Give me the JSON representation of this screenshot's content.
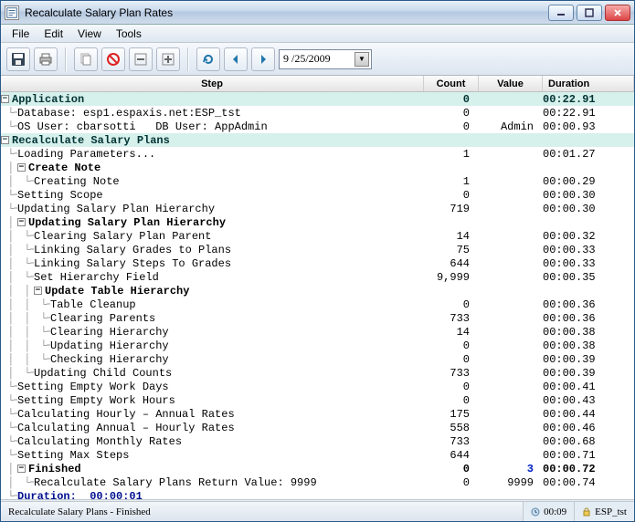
{
  "window": {
    "title": "Recalculate Salary Plan Rates"
  },
  "menu": {
    "file": "File",
    "edit": "Edit",
    "view": "View",
    "tools": "Tools"
  },
  "toolbar": {
    "date_value": "9 /25/2009"
  },
  "columns": {
    "step": "Step",
    "count": "Count",
    "value": "Value",
    "duration": "Duration"
  },
  "rows": [
    {
      "type": "header",
      "indent": 0,
      "toggle": "-",
      "label": "Application",
      "count": "0",
      "value": "",
      "duration": "00:22.91"
    },
    {
      "type": "item",
      "indent": 1,
      "label": "Database: esp1.espaxis.net:ESP_tst",
      "count": "0",
      "value": "",
      "duration": "00:22.91"
    },
    {
      "type": "item",
      "indent": 1,
      "label": "OS User: cbarsotti   DB User: AppAdmin",
      "count": "0",
      "value": "Admin",
      "duration": "00:00.93"
    },
    {
      "type": "header",
      "indent": 0,
      "toggle": "-",
      "label": "Recalculate Salary Plans",
      "count": "",
      "value": "",
      "duration": ""
    },
    {
      "type": "item",
      "indent": 1,
      "label": "Loading Parameters...",
      "count": "1",
      "value": "",
      "duration": "00:01.27"
    },
    {
      "type": "bold",
      "indent": 1,
      "toggle": "-",
      "label": "Create Note",
      "count": "",
      "value": "",
      "duration": ""
    },
    {
      "type": "item",
      "indent": 2,
      "label": "Creating Note",
      "count": "1",
      "value": "",
      "duration": "00:00.29"
    },
    {
      "type": "item",
      "indent": 1,
      "label": "Setting Scope",
      "count": "0",
      "value": "",
      "duration": "00:00.30"
    },
    {
      "type": "item",
      "indent": 1,
      "label": "Updating Salary Plan Hierarchy",
      "count": "719",
      "value": "",
      "duration": "00:00.30"
    },
    {
      "type": "bold",
      "indent": 1,
      "toggle": "-",
      "label": "Updating Salary Plan Hierarchy",
      "count": "",
      "value": "",
      "duration": ""
    },
    {
      "type": "item",
      "indent": 2,
      "label": "Clearing Salary Plan Parent",
      "count": "14",
      "value": "",
      "duration": "00:00.32"
    },
    {
      "type": "item",
      "indent": 2,
      "label": "Linking Salary Grades to Plans",
      "count": "75",
      "value": "",
      "duration": "00:00.33"
    },
    {
      "type": "item",
      "indent": 2,
      "label": "Linking Salary Steps To Grades",
      "count": "644",
      "value": "",
      "duration": "00:00.33"
    },
    {
      "type": "item",
      "indent": 2,
      "label": "Set Hierarchy Field",
      "count": "9,999",
      "value": "",
      "duration": "00:00.35"
    },
    {
      "type": "bold",
      "indent": 2,
      "toggle": "-",
      "label": "Update Table Hierarchy",
      "count": "",
      "value": "",
      "duration": ""
    },
    {
      "type": "item",
      "indent": 3,
      "label": "Table Cleanup",
      "count": "0",
      "value": "",
      "duration": "00:00.36"
    },
    {
      "type": "item",
      "indent": 3,
      "label": "Clearing Parents",
      "count": "733",
      "value": "",
      "duration": "00:00.36"
    },
    {
      "type": "item",
      "indent": 3,
      "label": "Clearing Hierarchy",
      "count": "14",
      "value": "",
      "duration": "00:00.38"
    },
    {
      "type": "item",
      "indent": 3,
      "label": "Updating Hierarchy",
      "count": "0",
      "value": "",
      "duration": "00:00.38"
    },
    {
      "type": "item",
      "indent": 3,
      "label": "Checking Hierarchy",
      "count": "0",
      "value": "",
      "duration": "00:00.39"
    },
    {
      "type": "item",
      "indent": 2,
      "label": "Updating Child Counts",
      "count": "733",
      "value": "",
      "duration": "00:00.39"
    },
    {
      "type": "item",
      "indent": 1,
      "label": "Setting Empty Work Days",
      "count": "0",
      "value": "",
      "duration": "00:00.41"
    },
    {
      "type": "item",
      "indent": 1,
      "label": "Setting Empty Work Hours",
      "count": "0",
      "value": "",
      "duration": "00:00.43"
    },
    {
      "type": "item",
      "indent": 1,
      "label": "Calculating Hourly – Annual Rates",
      "count": "175",
      "value": "",
      "duration": "00:00.44"
    },
    {
      "type": "item",
      "indent": 1,
      "label": "Calculating Annual – Hourly Rates",
      "count": "558",
      "value": "",
      "duration": "00:00.46"
    },
    {
      "type": "item",
      "indent": 1,
      "label": "Calculating Monthly Rates",
      "count": "733",
      "value": "",
      "duration": "00:00.68"
    },
    {
      "type": "item",
      "indent": 1,
      "label": "Setting Max Steps",
      "count": "644",
      "value": "",
      "duration": "00:00.71"
    },
    {
      "type": "boldblue",
      "indent": 1,
      "toggle": "-",
      "label": "Finished",
      "count": "0",
      "value": "3",
      "duration": "00:00.72"
    },
    {
      "type": "item",
      "indent": 2,
      "label": "Recalculate Salary Plans Return Value: 9999",
      "count": "0",
      "value": "9999",
      "duration": "00:00.74"
    },
    {
      "type": "durline",
      "indent": 1,
      "label": "Duration:  00:00:01",
      "count": "",
      "value": "",
      "duration": ""
    }
  ],
  "status": {
    "text": "Recalculate Salary Plans - Finished",
    "time": "00:09",
    "db": "ESP_tst"
  }
}
